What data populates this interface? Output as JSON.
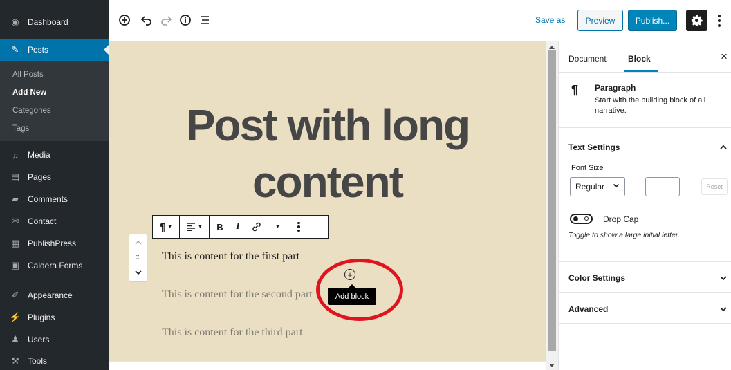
{
  "sidebar": {
    "dashboard": "Dashboard",
    "posts": "Posts",
    "submenu": [
      "All Posts",
      "Add New",
      "Categories",
      "Tags"
    ],
    "items": [
      "Media",
      "Pages",
      "Comments",
      "Contact",
      "PublishPress",
      "Caldera Forms",
      "Appearance",
      "Plugins",
      "Users",
      "Tools"
    ]
  },
  "toolbar": {
    "save_as": "Save as",
    "preview": "Preview",
    "publish": "Publish..."
  },
  "editor": {
    "title_line1": "Post with long",
    "title_line2": "content",
    "paragraphs": [
      "This is content for the first part",
      "This is content for the second part",
      "This is content for the third part"
    ],
    "add_block_tooltip": "Add block"
  },
  "panel": {
    "tabs": [
      "Document",
      "Block"
    ],
    "active_tab": "Block",
    "block_name": "Paragraph",
    "block_description": "Start with the building block of all narrative.",
    "text_settings": "Text Settings",
    "font_size_label": "Font Size",
    "font_size_value": "Regular",
    "reset": "Reset",
    "drop_cap": "Drop Cap",
    "drop_cap_help": "Toggle to show a large initial letter.",
    "color_settings": "Color Settings",
    "advanced": "Advanced"
  },
  "colors": {
    "canvas_bg": "#ebdfc3",
    "sidebar_bg": "#23282d",
    "active_menu": "#0073aa",
    "publish_button": "#0085ba",
    "annotation_ellipse": "#e0141e"
  }
}
